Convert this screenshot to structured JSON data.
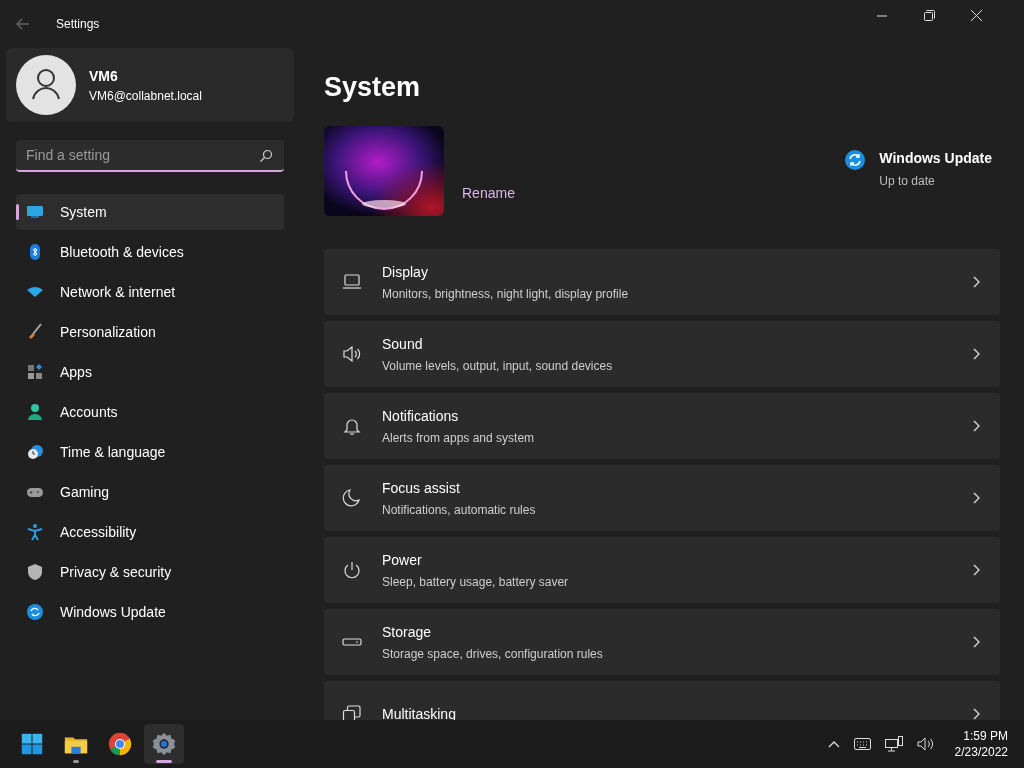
{
  "window": {
    "title": "Settings"
  },
  "account": {
    "name": "VM6",
    "email": "VM6@collabnet.local"
  },
  "search": {
    "placeholder": "Find a setting"
  },
  "sidebar": {
    "items": [
      {
        "label": "System",
        "selected": true
      },
      {
        "label": "Bluetooth & devices",
        "selected": false
      },
      {
        "label": "Network & internet",
        "selected": false
      },
      {
        "label": "Personalization",
        "selected": false
      },
      {
        "label": "Apps",
        "selected": false
      },
      {
        "label": "Accounts",
        "selected": false
      },
      {
        "label": "Time & language",
        "selected": false
      },
      {
        "label": "Gaming",
        "selected": false
      },
      {
        "label": "Accessibility",
        "selected": false
      },
      {
        "label": "Privacy & security",
        "selected": false
      },
      {
        "label": "Windows Update",
        "selected": false
      }
    ]
  },
  "page": {
    "title": "System",
    "rename": "Rename",
    "update": {
      "title": "Windows Update",
      "status": "Up to date"
    }
  },
  "cards": [
    {
      "title": "Display",
      "subtitle": "Monitors, brightness, night light, display profile"
    },
    {
      "title": "Sound",
      "subtitle": "Volume levels, output, input, sound devices"
    },
    {
      "title": "Notifications",
      "subtitle": "Alerts from apps and system"
    },
    {
      "title": "Focus assist",
      "subtitle": "Notifications, automatic rules"
    },
    {
      "title": "Power",
      "subtitle": "Sleep, battery usage, battery saver"
    },
    {
      "title": "Storage",
      "subtitle": "Storage space, drives, configuration rules"
    },
    {
      "title": "Multitasking"
    }
  ],
  "taskbar": {
    "apps": [
      {
        "kind": "start",
        "running": false,
        "selected": false
      },
      {
        "kind": "folder",
        "running": true,
        "selected": false
      },
      {
        "kind": "browser",
        "running": false,
        "selected": false
      },
      {
        "kind": "settings",
        "running": true,
        "selected": true
      }
    ],
    "time": "1:59 PM",
    "date": "2/23/2022"
  }
}
